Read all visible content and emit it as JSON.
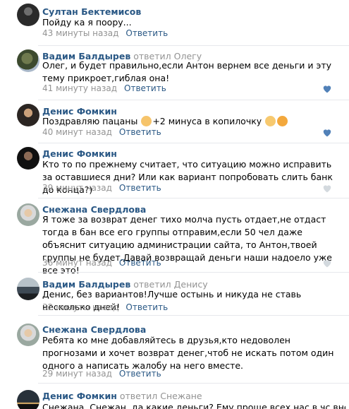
{
  "reply_label": "Ответить",
  "comments": [
    {
      "author": "Султан Бектемисов",
      "text": "Пойду ка я поору...",
      "time": "43 минуты назад",
      "liked": false
    },
    {
      "author": "Вадим Балдырев",
      "reply_prefix": "ответил",
      "reply_to": "Олегу",
      "text": "Олег, и будет правильно,если Антон вернем все деньги и эту тему прикроет,гиблая она!",
      "time": "41 минуту назад",
      "liked": true
    },
    {
      "author": "Денис Фомкин",
      "text_before": "Поздравляю пацаны ",
      "text_middle": "+2 минуса в копилочку ",
      "time": "40 минут назад",
      "liked": true
    },
    {
      "author": "Денис Фомкин",
      "text": "Кто то по прежнему считает, что ситуацию можно исправить за оставшиеся дни? Или как вариант попробовать слить банк до конца?)",
      "time": "39 минут назад",
      "liked": false
    },
    {
      "author": "Снежана Свердлова",
      "text": "Я тоже за возврат денег тихо молча пусть отдает,не отдаст тогда в бан все его группы отправим,если 50 чел даже объяснит ситуацию администрации сайта, то Антон,твоей группы не будет.Давай возвращай деньги наши надоело уже все это!",
      "time": "36 минут назад",
      "liked": false
    },
    {
      "author": "Вадим Балдырев",
      "reply_prefix": "ответил",
      "reply_to": "Денису",
      "text": "Денис, без вариантов!Лучше остынь и никуда не ставь несколько дней!",
      "time": "32 минуты назад",
      "liked": false
    },
    {
      "author": "Снежана Свердлова",
      "text": "Ребята ко мне добавляйтесь в друзья,кто недоволен прогнозами и хочет возврат денег,чтоб не искать потом один одного а написать жалобу на него вместе.",
      "time": "29 минут назад",
      "liked": false
    },
    {
      "author": "Денис Фомкин",
      "reply_prefix": "ответил",
      "reply_to": "Снежане",
      "text": "Снежана, Снежан, да какие деньги? Ему проще всех нас в чс внести, потом",
      "time": "",
      "liked": false
    }
  ],
  "icons": {
    "like": "heart-icon",
    "like_color_active": "#5181b8",
    "like_color_inactive": "#d3d9de"
  }
}
